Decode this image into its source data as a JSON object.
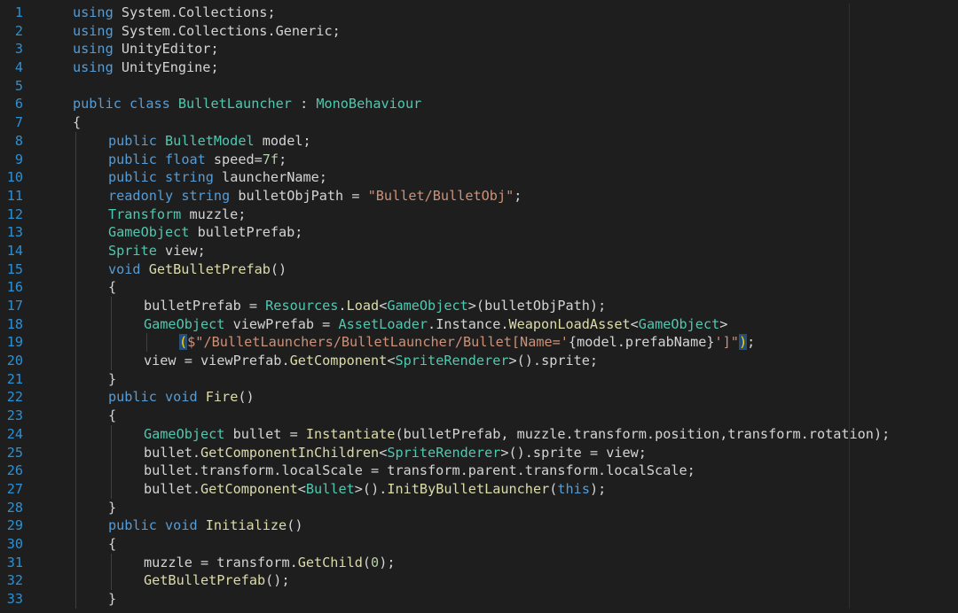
{
  "editor": {
    "colors": {
      "background": "#1e1e1e",
      "line_number": "#2b91d6",
      "keyword": "#569cd6",
      "type": "#4ec9b0",
      "method": "#dcdcaa",
      "string": "#ce9178",
      "number": "#b5cea8",
      "default": "#d4d4d4"
    },
    "lines": [
      {
        "n": "1",
        "indent": 0,
        "tokens": [
          {
            "t": "using",
            "k": "keyword"
          },
          {
            "t": " System.Collections;",
            "k": "ident"
          }
        ]
      },
      {
        "n": "2",
        "indent": 0,
        "tokens": [
          {
            "t": "using",
            "k": "keyword"
          },
          {
            "t": " System.Collections.Generic;",
            "k": "ident"
          }
        ]
      },
      {
        "n": "3",
        "indent": 0,
        "tokens": [
          {
            "t": "using",
            "k": "keyword"
          },
          {
            "t": " UnityEditor;",
            "k": "ident"
          }
        ]
      },
      {
        "n": "4",
        "indent": 0,
        "tokens": [
          {
            "t": "using",
            "k": "keyword"
          },
          {
            "t": " UnityEngine;",
            "k": "ident"
          }
        ]
      },
      {
        "n": "5",
        "indent": 0,
        "tokens": []
      },
      {
        "n": "6",
        "indent": 0,
        "tokens": [
          {
            "t": "public",
            "k": "keyword"
          },
          {
            "t": " ",
            "k": "ident"
          },
          {
            "t": "class",
            "k": "keyword"
          },
          {
            "t": " ",
            "k": "ident"
          },
          {
            "t": "BulletLauncher",
            "k": "type"
          },
          {
            "t": " : ",
            "k": "ident"
          },
          {
            "t": "MonoBehaviour",
            "k": "type"
          }
        ]
      },
      {
        "n": "7",
        "indent": 0,
        "tokens": [
          {
            "t": "{",
            "k": "ident"
          }
        ]
      },
      {
        "n": "8",
        "indent": 1,
        "tokens": [
          {
            "t": "public",
            "k": "keyword"
          },
          {
            "t": " ",
            "k": "ident"
          },
          {
            "t": "BulletModel",
            "k": "type"
          },
          {
            "t": " model;",
            "k": "ident"
          }
        ]
      },
      {
        "n": "9",
        "indent": 1,
        "tokens": [
          {
            "t": "public",
            "k": "keyword"
          },
          {
            "t": " ",
            "k": "ident"
          },
          {
            "t": "float",
            "k": "keyword"
          },
          {
            "t": " speed=",
            "k": "ident"
          },
          {
            "t": "7f",
            "k": "number"
          },
          {
            "t": ";",
            "k": "ident"
          }
        ]
      },
      {
        "n": "10",
        "indent": 1,
        "tokens": [
          {
            "t": "public",
            "k": "keyword"
          },
          {
            "t": " ",
            "k": "ident"
          },
          {
            "t": "string",
            "k": "keyword"
          },
          {
            "t": " launcherName;",
            "k": "ident"
          }
        ]
      },
      {
        "n": "11",
        "indent": 1,
        "tokens": [
          {
            "t": "readonly",
            "k": "keyword"
          },
          {
            "t": " ",
            "k": "ident"
          },
          {
            "t": "string",
            "k": "keyword"
          },
          {
            "t": " bulletObjPath = ",
            "k": "ident"
          },
          {
            "t": "\"Bullet/BulletObj\"",
            "k": "string"
          },
          {
            "t": ";",
            "k": "ident"
          }
        ]
      },
      {
        "n": "12",
        "indent": 1,
        "tokens": [
          {
            "t": "Transform",
            "k": "type"
          },
          {
            "t": " muzzle;",
            "k": "ident"
          }
        ]
      },
      {
        "n": "13",
        "indent": 1,
        "tokens": [
          {
            "t": "GameObject",
            "k": "type"
          },
          {
            "t": " bulletPrefab;",
            "k": "ident"
          }
        ]
      },
      {
        "n": "14",
        "indent": 1,
        "tokens": [
          {
            "t": "Sprite",
            "k": "type"
          },
          {
            "t": " view;",
            "k": "ident"
          }
        ]
      },
      {
        "n": "15",
        "indent": 1,
        "tokens": [
          {
            "t": "void",
            "k": "keyword"
          },
          {
            "t": " ",
            "k": "ident"
          },
          {
            "t": "GetBulletPrefab",
            "k": "method"
          },
          {
            "t": "()",
            "k": "ident"
          }
        ]
      },
      {
        "n": "16",
        "indent": 1,
        "tokens": [
          {
            "t": "{",
            "k": "ident"
          }
        ]
      },
      {
        "n": "17",
        "indent": 2,
        "tokens": [
          {
            "t": "bulletPrefab = ",
            "k": "ident"
          },
          {
            "t": "Resources",
            "k": "type"
          },
          {
            "t": ".",
            "k": "ident"
          },
          {
            "t": "Load",
            "k": "method"
          },
          {
            "t": "<",
            "k": "ident"
          },
          {
            "t": "GameObject",
            "k": "type"
          },
          {
            "t": ">(bulletObjPath);",
            "k": "ident"
          }
        ]
      },
      {
        "n": "18",
        "indent": 2,
        "tokens": [
          {
            "t": "GameObject",
            "k": "type"
          },
          {
            "t": " viewPrefab = ",
            "k": "ident"
          },
          {
            "t": "AssetLoader",
            "k": "type"
          },
          {
            "t": ".Instance.",
            "k": "ident"
          },
          {
            "t": "WeaponLoadAsset",
            "k": "method"
          },
          {
            "t": "<",
            "k": "ident"
          },
          {
            "t": "GameObject",
            "k": "type"
          },
          {
            "t": ">",
            "k": "ident"
          }
        ]
      },
      {
        "n": "19",
        "indent": 3,
        "tokens": [
          {
            "t": "(",
            "k": "paren-match"
          },
          {
            "t": "$\"/BulletLaunchers/BulletLauncher/Bullet[Name='",
            "k": "string"
          },
          {
            "t": "{model.prefabName}",
            "k": "ident"
          },
          {
            "t": "']\"",
            "k": "string"
          },
          {
            "t": ")",
            "k": "paren-match"
          },
          {
            "t": ";",
            "k": "ident"
          }
        ]
      },
      {
        "n": "20",
        "indent": 2,
        "tokens": [
          {
            "t": "view = viewPrefab.",
            "k": "ident"
          },
          {
            "t": "GetComponent",
            "k": "method"
          },
          {
            "t": "<",
            "k": "ident"
          },
          {
            "t": "SpriteRenderer",
            "k": "type"
          },
          {
            "t": ">().sprite;",
            "k": "ident"
          }
        ]
      },
      {
        "n": "21",
        "indent": 1,
        "tokens": [
          {
            "t": "}",
            "k": "ident"
          }
        ]
      },
      {
        "n": "22",
        "indent": 1,
        "tokens": [
          {
            "t": "public",
            "k": "keyword"
          },
          {
            "t": " ",
            "k": "ident"
          },
          {
            "t": "void",
            "k": "keyword"
          },
          {
            "t": " ",
            "k": "ident"
          },
          {
            "t": "Fire",
            "k": "method"
          },
          {
            "t": "()",
            "k": "ident"
          }
        ]
      },
      {
        "n": "23",
        "indent": 1,
        "tokens": [
          {
            "t": "{",
            "k": "ident"
          }
        ]
      },
      {
        "n": "24",
        "indent": 2,
        "tokens": [
          {
            "t": "GameObject",
            "k": "type"
          },
          {
            "t": " bullet = ",
            "k": "ident"
          },
          {
            "t": "Instantiate",
            "k": "method"
          },
          {
            "t": "(bulletPrefab, muzzle.transform.position,transform.rotation);",
            "k": "ident"
          }
        ]
      },
      {
        "n": "25",
        "indent": 2,
        "tokens": [
          {
            "t": "bullet.",
            "k": "ident"
          },
          {
            "t": "GetComponentInChildren",
            "k": "method"
          },
          {
            "t": "<",
            "k": "ident"
          },
          {
            "t": "SpriteRenderer",
            "k": "type"
          },
          {
            "t": ">().sprite = view;",
            "k": "ident"
          }
        ]
      },
      {
        "n": "26",
        "indent": 2,
        "tokens": [
          {
            "t": "bullet.transform.localScale = transform.parent.transform.localScale;",
            "k": "ident"
          }
        ]
      },
      {
        "n": "27",
        "indent": 2,
        "tokens": [
          {
            "t": "bullet.",
            "k": "ident"
          },
          {
            "t": "GetComponent",
            "k": "method"
          },
          {
            "t": "<",
            "k": "ident"
          },
          {
            "t": "Bullet",
            "k": "type"
          },
          {
            "t": ">().",
            "k": "ident"
          },
          {
            "t": "InitByBulletLauncher",
            "k": "method"
          },
          {
            "t": "(",
            "k": "ident"
          },
          {
            "t": "this",
            "k": "keyword"
          },
          {
            "t": ");",
            "k": "ident"
          }
        ]
      },
      {
        "n": "28",
        "indent": 1,
        "tokens": [
          {
            "t": "}",
            "k": "ident"
          }
        ]
      },
      {
        "n": "29",
        "indent": 1,
        "tokens": [
          {
            "t": "public",
            "k": "keyword"
          },
          {
            "t": " ",
            "k": "ident"
          },
          {
            "t": "void",
            "k": "keyword"
          },
          {
            "t": " ",
            "k": "ident"
          },
          {
            "t": "Initialize",
            "k": "method"
          },
          {
            "t": "()",
            "k": "ident"
          }
        ]
      },
      {
        "n": "30",
        "indent": 1,
        "tokens": [
          {
            "t": "{",
            "k": "ident"
          }
        ]
      },
      {
        "n": "31",
        "indent": 2,
        "tokens": [
          {
            "t": "muzzle = transform.",
            "k": "ident"
          },
          {
            "t": "GetChild",
            "k": "method"
          },
          {
            "t": "(",
            "k": "ident"
          },
          {
            "t": "0",
            "k": "number"
          },
          {
            "t": ");",
            "k": "ident"
          }
        ]
      },
      {
        "n": "32",
        "indent": 2,
        "tokens": [
          {
            "t": "GetBulletPrefab",
            "k": "method"
          },
          {
            "t": "();",
            "k": "ident"
          }
        ]
      },
      {
        "n": "33",
        "indent": 1,
        "tokens": [
          {
            "t": "}",
            "k": "ident"
          }
        ]
      }
    ]
  }
}
